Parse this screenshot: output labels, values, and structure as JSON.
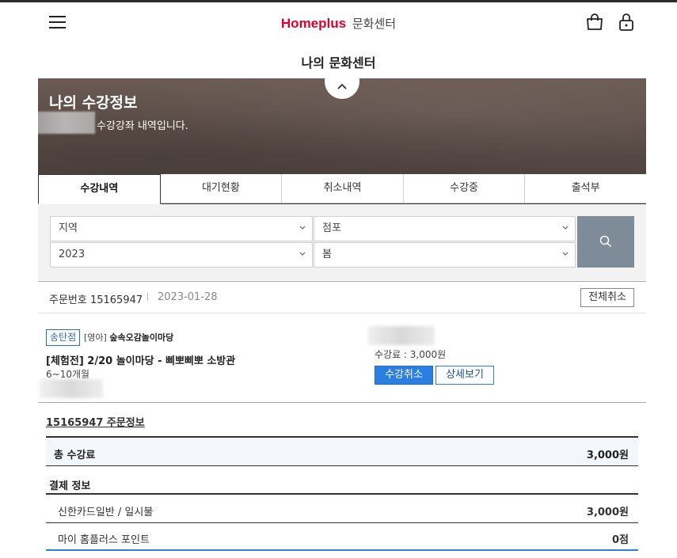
{
  "header": {
    "brand": "Homeplus",
    "brand_sub": "문화센터",
    "page_title": "나의 문화센터"
  },
  "banner": {
    "title": "나의 수강정보",
    "subtitle": "수강강좌 내역입니다."
  },
  "tabs": [
    {
      "label": "수강내역",
      "active": true
    },
    {
      "label": "대기현황",
      "active": false
    },
    {
      "label": "취소내역",
      "active": false
    },
    {
      "label": "수강중",
      "active": false
    },
    {
      "label": "출석부",
      "active": false
    }
  ],
  "filters": {
    "region": "지역",
    "store": "점포",
    "year": "2023",
    "season": "봄"
  },
  "order": {
    "number_text": "주문번호 15165947",
    "date": "2023-01-28",
    "cancel_all_label": "전체취소"
  },
  "course": {
    "branch": "송탄점",
    "category_prefix": "[영아]",
    "category_name": "숲속오감놀이마당",
    "title": "[체험전] 2/20 놀이마당 - 삐뽀삐뽀 소방관",
    "age": "6~10개월",
    "fee": "수강료 : 3,000원",
    "cancel_label": "수강취소",
    "detail_label": "상세보기"
  },
  "order_info": {
    "link_text": "15165947 주문정보",
    "total_label": "총 수강료",
    "total_value": "3,000원",
    "payment_header": "결제 정보",
    "payments": [
      {
        "label": "신한카드일반 / 일시불",
        "value": "3,000원"
      },
      {
        "label": "마이 홈플러스 포인트",
        "value": "0점"
      }
    ]
  },
  "colors": {
    "brand_red": "#e0002a",
    "primary_blue": "#2c7fe0",
    "search_button": "#7e8c9a",
    "banner_bg": "#5f504a"
  },
  "icons": [
    "menu-icon",
    "shopping-bag-icon",
    "lock-icon",
    "chevron-up-icon",
    "chevron-down-icon",
    "search-icon"
  ]
}
